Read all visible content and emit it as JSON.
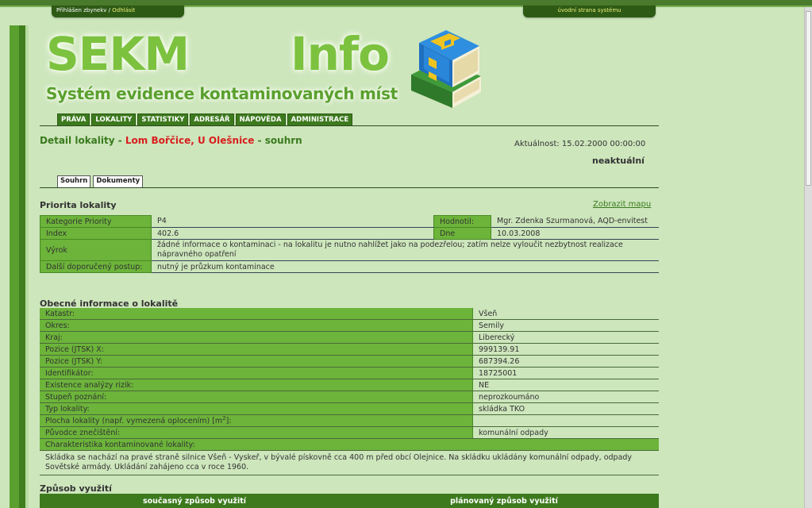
{
  "top": {
    "login_text": "Přihlášen zbynekv",
    "separator": "/",
    "logout_label": "Odhlásit",
    "home_label": "úvodní strana systému"
  },
  "logo": {
    "part1": "SEKM",
    "part2": "Info",
    "subtitle": "Systém evidence kontaminovaných míst",
    "image": "stack-of-books-icon"
  },
  "menu": [
    "PRÁVA",
    "LOKALITY",
    "STATISTIKY",
    "ADRESÁŘ",
    "NÁPOVĚDA",
    "ADMINISTRACE"
  ],
  "detail": {
    "prefix": "Detail lokality - ",
    "name": "Lom Bořčice, U Olešnice",
    "suffix": " - souhrn",
    "aktualnost": "Aktuálnost: 15.02.2000 00:00:00",
    "status": "neaktuální"
  },
  "tabs": [
    "Souhrn",
    "Dokumenty"
  ],
  "priorita": {
    "heading": "Priorita lokality",
    "map_link": "Zobrazit mapu",
    "kategorie_label": "Kategorie Priority",
    "kategorie": "P4",
    "hodnotil_label": "Hodnotil:",
    "hodnotil": "Mgr. Zdenka Szurmanová, AQD-envitest",
    "index_label": "Index",
    "index": "402.6",
    "dne_label": "Dne",
    "dne": "10.03.2008",
    "vyrok_label": "Výrok",
    "vyrok": "žádné informace o kontaminaci - na lokalitu je nutno nahlížet jako na podezřelou; zatím nelze vyloučit nezbytnost realizace nápravného opatření",
    "postup_label": "Další doporučený postup:",
    "postup": "nutný je průzkum kontaminace"
  },
  "obecne": {
    "heading": "Obecné informace o lokalitě",
    "rows": [
      {
        "label": "Katastr:",
        "value": "Všeň"
      },
      {
        "label": "Okres:",
        "value": "Semily"
      },
      {
        "label": "Kraj:",
        "value": "Liberecký"
      },
      {
        "label": "Pozice (JTSK) X:",
        "value": "999139.91"
      },
      {
        "label": "Pozice (JTSK) Y:",
        "value": "687394.26"
      },
      {
        "label": "Identifikátor:",
        "value": "18725001"
      },
      {
        "label": "Existence analýzy rizik:",
        "value": "NE"
      },
      {
        "label": "Stupeň poznání:",
        "value": "neprozkoumáno"
      },
      {
        "label": "Typ lokality:",
        "value": "skládka TKO"
      },
      {
        "label": "Plocha lokality (např. vymezená oplocením) [m",
        "sup": "2",
        "label_end": "]:",
        "value": ""
      },
      {
        "label": "Původce znečištění:",
        "value": "komunální odpady"
      }
    ],
    "char_label": "Charakteristika kontaminované lokality:",
    "char_text": "Skládka se nachází na pravé straně silnice Všeň - Vyskeř, v bývalé pískovně cca 400 m před obcí Olejnice. Na skládku ukládány komunální odpady, odpady Sovětské armády. Ukládání zahájeno cca v roce 1960."
  },
  "vyuziti": {
    "heading": "Způsob využití",
    "col1": "současný způsob využití",
    "col2": "plánovaný způsob využití"
  }
}
